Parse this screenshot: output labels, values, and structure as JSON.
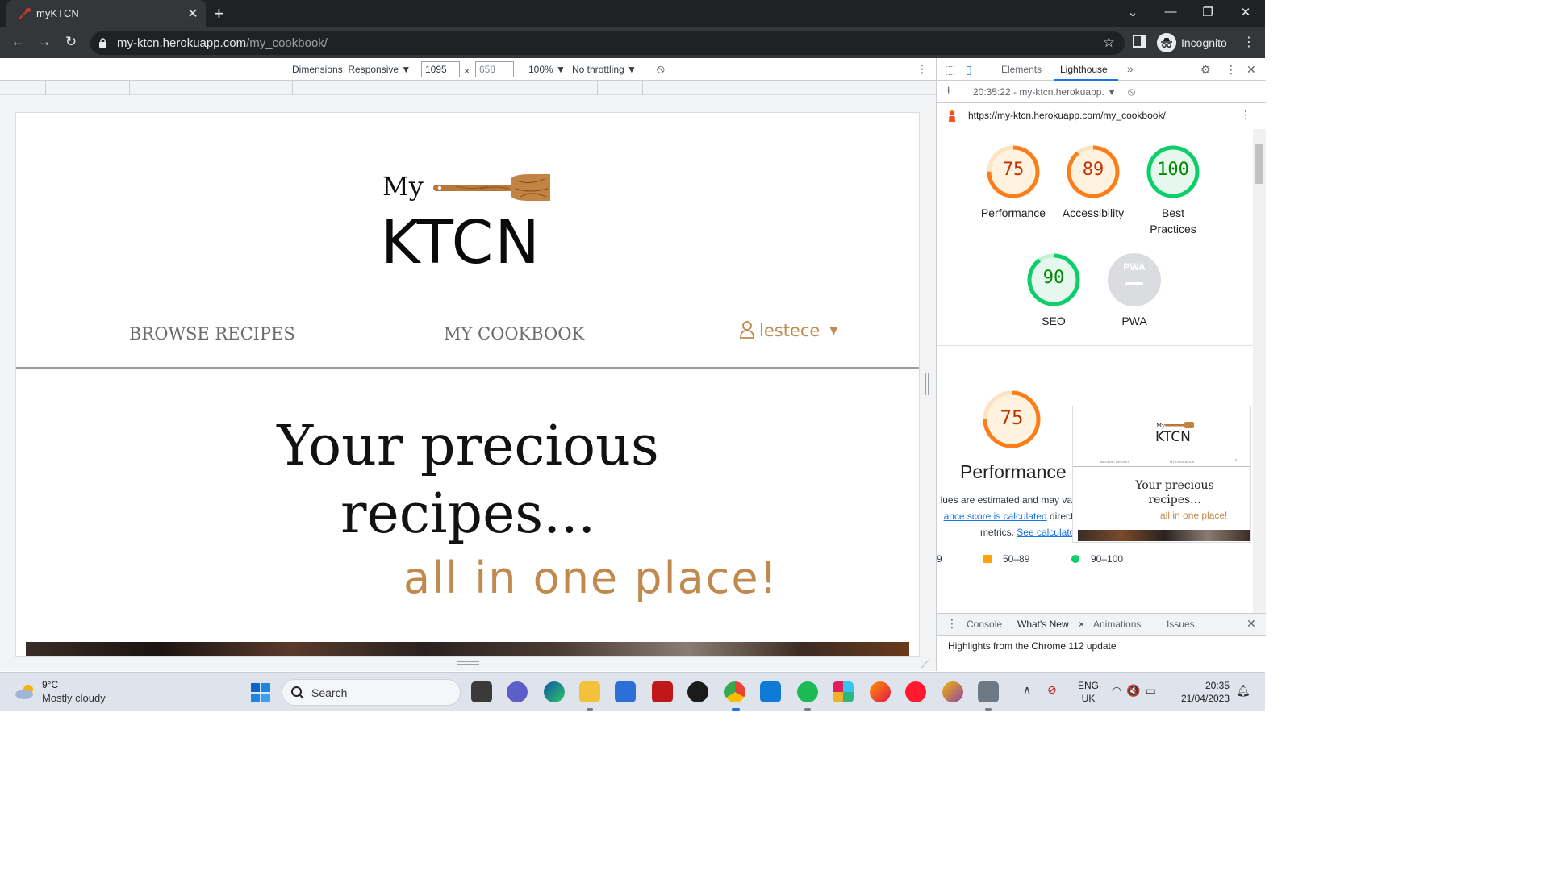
{
  "browser": {
    "tab_title": "myKTCN",
    "url_host": "my-ktcn.herokuapp.com",
    "url_path": "/my_cookbook/",
    "profile_label": "Incognito"
  },
  "device_toolbar": {
    "dimensions_label": "Dimensions: Responsive ▼",
    "width_value": "1095",
    "height_value": "658",
    "times": "×",
    "zoom": "100% ▼",
    "throttling": "No throttling ▼"
  },
  "site": {
    "logo_my": "My",
    "logo_ktcn": "KTCN",
    "nav": {
      "browse": "BROWSE RECIPES",
      "cookbook": "MY COOKBOOK",
      "username": "lestece"
    },
    "hero": {
      "title": "Your precious recipes...",
      "subtitle": "all in one place!"
    }
  },
  "devtools": {
    "tabs": [
      "Elements",
      "Lighthouse"
    ],
    "more_tabs": "»",
    "report_label": "20:35:22 - my-ktcn.herokuapp. ▼",
    "report_url": "https://my-ktcn.herokuapp.com/my_cookbook/",
    "scores": [
      {
        "value": "75",
        "label": "Performance",
        "fraction": 0.75,
        "color": "#fa7f1b"
      },
      {
        "value": "89",
        "label": "Accessibility",
        "fraction": 0.89,
        "color": "#fa7f1b"
      },
      {
        "value": "100",
        "label": "Best Practices",
        "fraction": 1.0,
        "color": "#0cce6b"
      },
      {
        "value": "90",
        "label": "SEO",
        "fraction": 0.9,
        "color": "#0cce6b"
      }
    ],
    "pwa": {
      "badge": "PWA",
      "label": "PWA"
    },
    "perf_detail": {
      "value": "75",
      "label": "Performance",
      "note_line1": "lues are estimated and may vary",
      "note_link": "ance score is calculated",
      "note_line2_rest": " directly",
      "note_line3_prefix": "metrics. ",
      "see_calculator": "See calculator."
    },
    "thumb": {
      "my": "My",
      "ktcn": "KTCN",
      "nav_browse": "BROWSE RECIPES",
      "nav_cookbook": "MY COOKBOOK",
      "title": "Your precious recipes...",
      "subtitle": "all in one place!"
    },
    "legend": {
      "low": "9",
      "mid": "50–89",
      "high": "90–100"
    },
    "drawer": {
      "tabs": [
        "Console",
        "What's New",
        "Animations",
        "Issues"
      ],
      "close_x": "×",
      "message": "Highlights from the Chrome 112 update"
    }
  },
  "taskbar": {
    "weather_temp": "9°C",
    "weather_desc": "Mostly cloudy",
    "search_label": "Search",
    "lang_line1": "ENG",
    "lang_line2": "UK",
    "time": "20:35",
    "date": "21/04/2023"
  }
}
